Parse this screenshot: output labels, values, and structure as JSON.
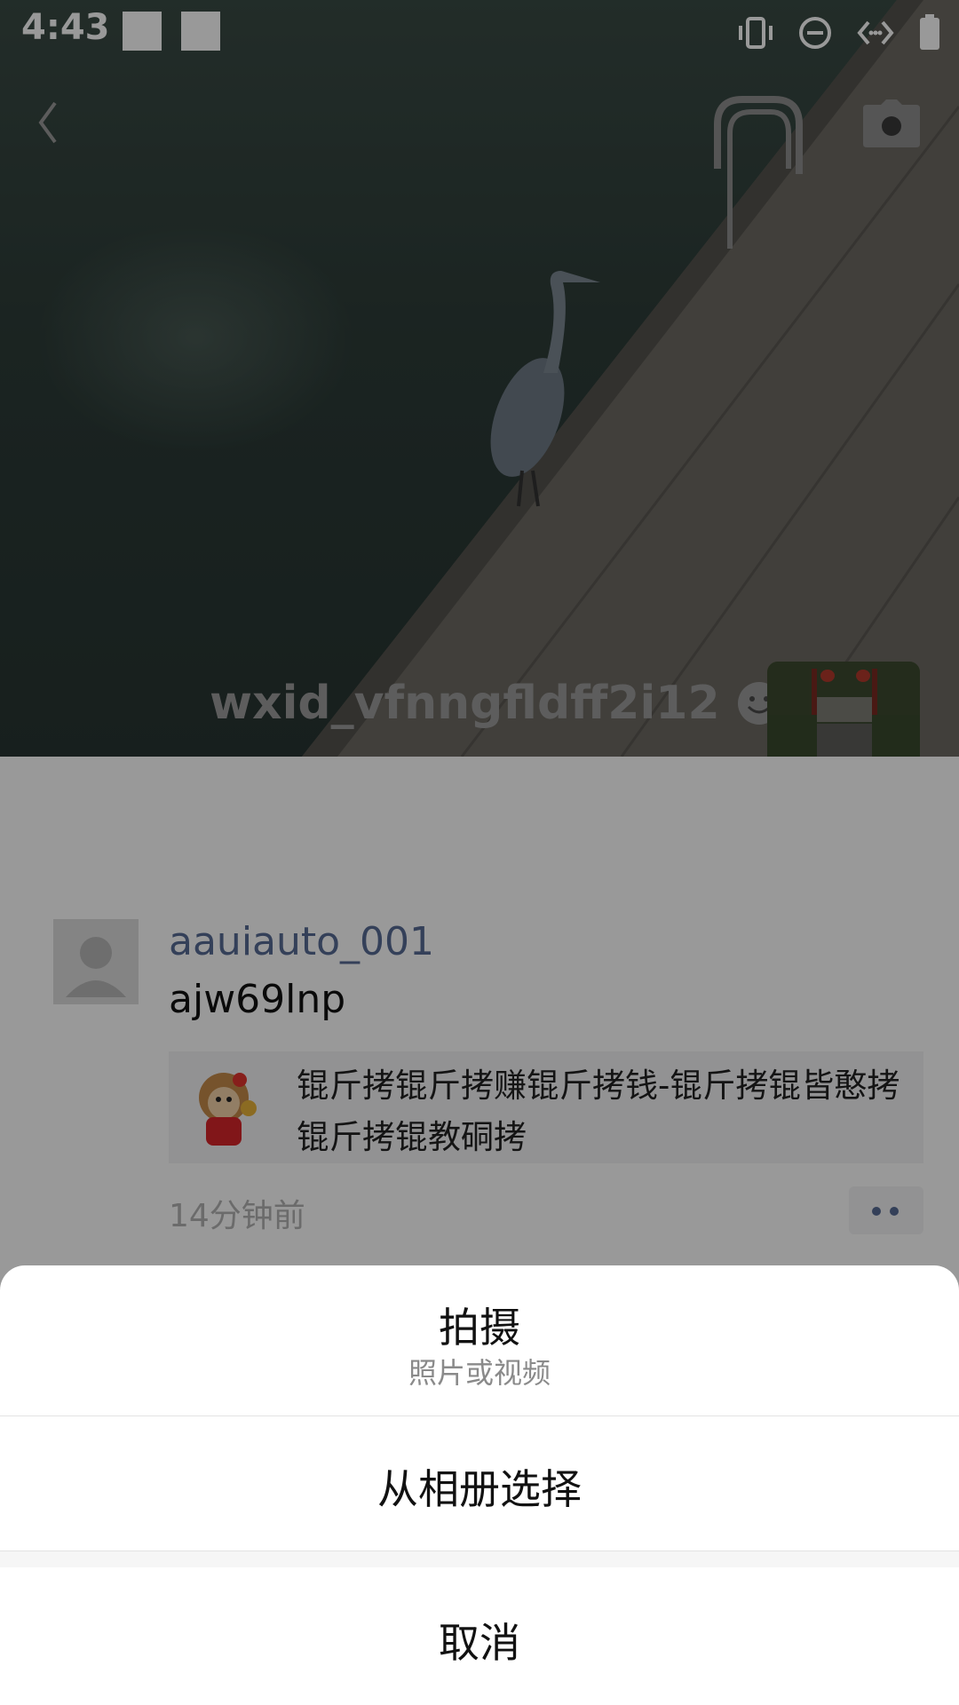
{
  "status_bar": {
    "time": "4:43",
    "icons": [
      "vibrate-icon",
      "do-not-disturb-icon",
      "data-sync-icon",
      "battery-icon"
    ]
  },
  "header": {
    "back_icon": "chevron-left-icon",
    "camera_icon": "camera-icon"
  },
  "profile": {
    "nickname": "wxid_vfnngfldff2i12",
    "emoji_icon": "smile-icon"
  },
  "post": {
    "username": "aauiauto_001",
    "text": "ajw69lnp",
    "share_text": "锟斤拷锟斤拷赚锟斤拷钱-锟斤拷锟皆憨拷锟斤拷锟教硐拷",
    "time": "14分钟前"
  },
  "action_sheet": {
    "shoot_label": "拍摄",
    "shoot_sub": "照片或视频",
    "album_label": "从相册选择",
    "cancel_label": "取消"
  },
  "colors": {
    "link_blue": "#576b95",
    "overlay": "rgba(0,0,0,0.40)",
    "sheet_bg": "#ffffff"
  }
}
